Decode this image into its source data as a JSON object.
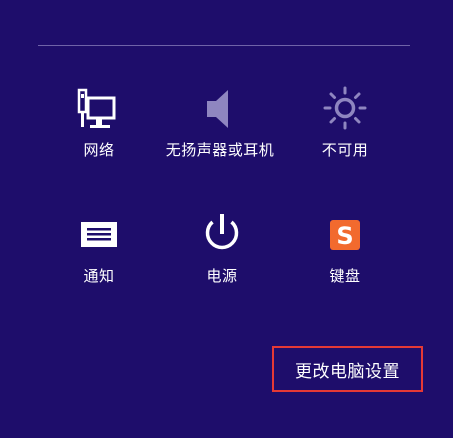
{
  "quick_settings": [
    {
      "label": "网络",
      "icon": "network-icon"
    },
    {
      "label": "无扬声器或耳机",
      "icon": "speaker-icon",
      "disabled": true
    },
    {
      "label": "不可用",
      "icon": "brightness-icon",
      "disabled": true
    },
    {
      "label": "通知",
      "icon": "notification-icon"
    },
    {
      "label": "电源",
      "icon": "power-icon"
    },
    {
      "label": "键盘",
      "icon": "keyboard-sogou-icon",
      "ime_glyph": "S"
    }
  ],
  "settings_link": {
    "label": "更改电脑设置"
  },
  "colors": {
    "background": "#1e0d6b",
    "highlight_border": "#e53935",
    "disabled_icon": "#8f86c0",
    "sogou_brand": "#f26a2e"
  }
}
